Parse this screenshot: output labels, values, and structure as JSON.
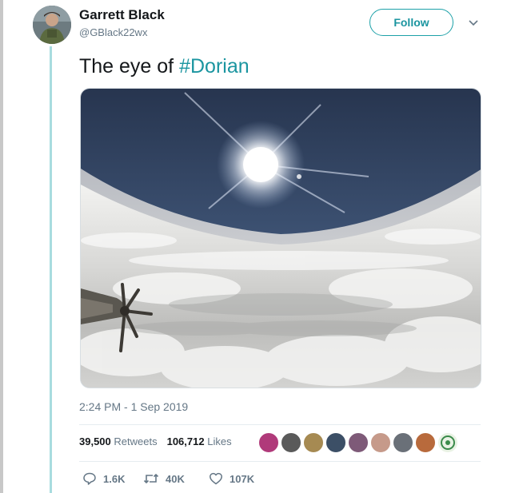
{
  "author": {
    "name": "Garrett Black",
    "handle": "@GBlack22wx"
  },
  "follow_label": "Follow",
  "tweet": {
    "text_prefix": "The eye of ",
    "hashtag": "#Dorian"
  },
  "timestamp": "2:24 PM - 1 Sep 2019",
  "stats": {
    "retweets_count": "39,500",
    "retweets_label": "Retweets",
    "likes_count": "106,712",
    "likes_label": "Likes"
  },
  "actions": {
    "replies": "1.6K",
    "retweets": "40K",
    "likes": "107K"
  },
  "colors": {
    "accent": "#1b95a0",
    "thread_line": "#a8dcdf",
    "muted_text": "#657786"
  },
  "icons": {
    "caret": "chevron-down-icon",
    "reply": "reply-icon",
    "retweet": "retweet-icon",
    "like": "heart-icon"
  }
}
